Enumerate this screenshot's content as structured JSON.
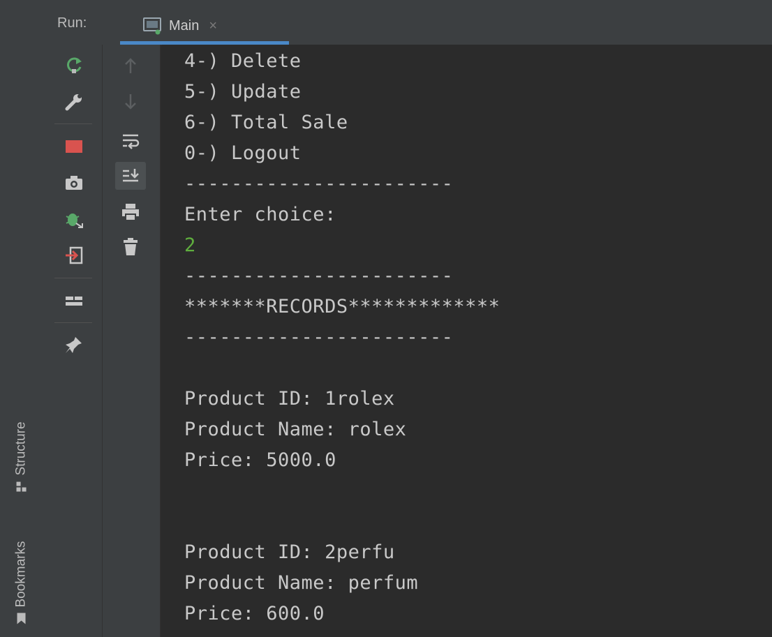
{
  "run_panel": {
    "label": "Run:",
    "tab": {
      "label": "Main",
      "close_glyph": "×"
    }
  },
  "side_tabs": {
    "structure": "Structure",
    "bookmarks": "Bookmarks"
  },
  "toolbar_left": [
    "rerun-icon",
    "wrench-icon",
    "stop-icon",
    "camera-icon",
    "debug-icon",
    "exit-icon",
    "layout-icon",
    "pin-icon"
  ],
  "toolbar_right": [
    "arrow-up-icon",
    "arrow-down-icon",
    "soft-wrap-icon",
    "scroll-to-end-icon",
    "print-icon",
    "trash-icon"
  ],
  "console": {
    "lines": [
      "4-) Delete",
      "5-) Update",
      "6-) Total Sale",
      "0-) Logout",
      "-----------------------",
      "Enter choice:",
      "2",
      "-----------------------",
      "*******RECORDS*************",
      "-----------------------",
      "",
      "Product ID: 1rolex",
      "Product Name: rolex",
      "Price: 5000.0",
      "",
      "",
      "Product ID: 2perfu",
      "Product Name: perfum",
      "Price: 600.0"
    ]
  },
  "colors": {
    "panel_bg": "#3c3f41",
    "console_bg": "#2b2b2b",
    "console_text": "#c9c9c9",
    "user_input": "#5fae3e",
    "tab_accent": "#4a88c7",
    "stop_red": "#d9534f"
  }
}
